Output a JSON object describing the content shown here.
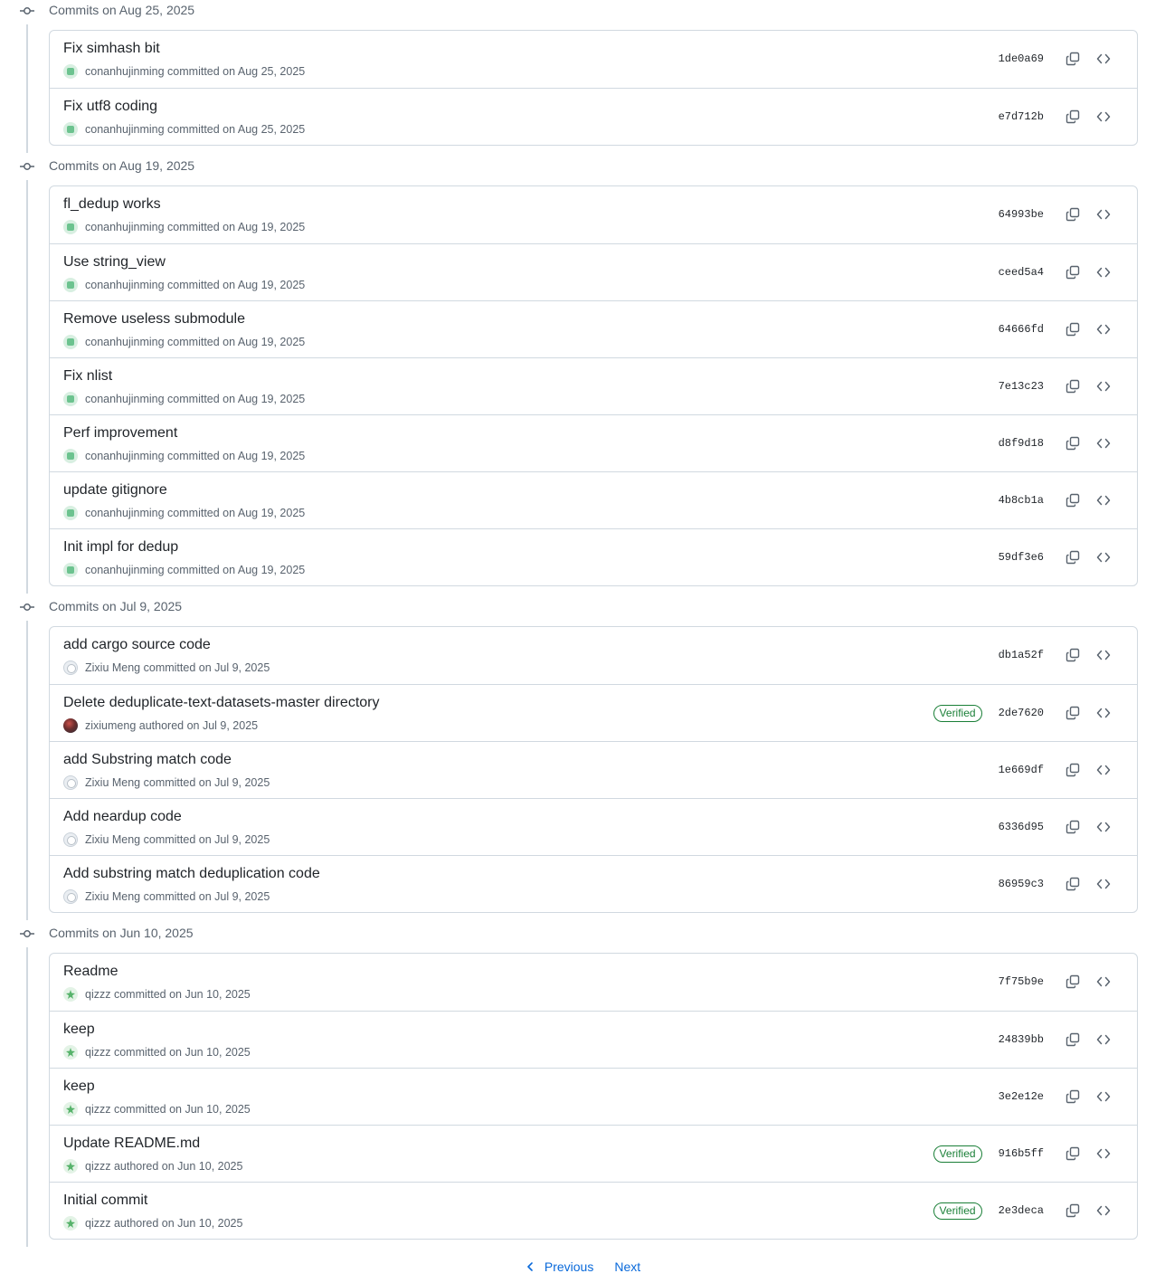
{
  "groups": [
    {
      "title": "Commits on Aug 25, 2025",
      "commits": [
        {
          "message": "Fix simhash bit",
          "author": "conanhujinming",
          "action": "committed on Aug 25, 2025",
          "sha": "1de0a69",
          "verified": false,
          "avatar": "green"
        },
        {
          "message": "Fix utf8 coding",
          "author": "conanhujinming",
          "action": "committed on Aug 25, 2025",
          "sha": "e7d712b",
          "verified": false,
          "avatar": "green"
        }
      ]
    },
    {
      "title": "Commits on Aug 19, 2025",
      "commits": [
        {
          "message": "fl_dedup works",
          "author": "conanhujinming",
          "action": "committed on Aug 19, 2025",
          "sha": "64993be",
          "verified": false,
          "avatar": "green"
        },
        {
          "message": "Use string_view",
          "author": "conanhujinming",
          "action": "committed on Aug 19, 2025",
          "sha": "ceed5a4",
          "verified": false,
          "avatar": "green"
        },
        {
          "message": "Remove useless submodule",
          "author": "conanhujinming",
          "action": "committed on Aug 19, 2025",
          "sha": "64666fd",
          "verified": false,
          "avatar": "green"
        },
        {
          "message": "Fix nlist",
          "author": "conanhujinming",
          "action": "committed on Aug 19, 2025",
          "sha": "7e13c23",
          "verified": false,
          "avatar": "green"
        },
        {
          "message": "Perf improvement",
          "author": "conanhujinming",
          "action": "committed on Aug 19, 2025",
          "sha": "d8f9d18",
          "verified": false,
          "avatar": "green"
        },
        {
          "message": "update gitignore",
          "author": "conanhujinming",
          "action": "committed on Aug 19, 2025",
          "sha": "4b8cb1a",
          "verified": false,
          "avatar": "green"
        },
        {
          "message": "Init impl for dedup",
          "author": "conanhujinming",
          "action": "committed on Aug 19, 2025",
          "sha": "59df3e6",
          "verified": false,
          "avatar": "green"
        }
      ]
    },
    {
      "title": "Commits on Jul 9, 2025",
      "commits": [
        {
          "message": "add cargo source code",
          "author": "Zixiu Meng",
          "action": "committed on Jul 9, 2025",
          "sha": "db1a52f",
          "verified": false,
          "avatar": "gray"
        },
        {
          "message": "Delete deduplicate-text-datasets-master directory",
          "author": "zixiumeng",
          "action": "authored on Jul 9, 2025",
          "sha": "2de7620",
          "verified": true,
          "avatar": "dark"
        },
        {
          "message": "add Substring match code",
          "author": "Zixiu Meng",
          "action": "committed on Jul 9, 2025",
          "sha": "1e669df",
          "verified": false,
          "avatar": "gray"
        },
        {
          "message": "Add neardup code",
          "author": "Zixiu Meng",
          "action": "committed on Jul 9, 2025",
          "sha": "6336d95",
          "verified": false,
          "avatar": "gray"
        },
        {
          "message": "Add substring match deduplication code",
          "author": "Zixiu Meng",
          "action": "committed on Jul 9, 2025",
          "sha": "86959c3",
          "verified": false,
          "avatar": "gray"
        }
      ]
    },
    {
      "title": "Commits on Jun 10, 2025",
      "commits": [
        {
          "message": "Readme",
          "author": "qizzz",
          "action": "committed on Jun 10, 2025",
          "sha": "7f75b9e",
          "verified": false,
          "avatar": "mint"
        },
        {
          "message": "keep",
          "author": "qizzz",
          "action": "committed on Jun 10, 2025",
          "sha": "24839bb",
          "verified": false,
          "avatar": "mint"
        },
        {
          "message": "keep",
          "author": "qizzz",
          "action": "committed on Jun 10, 2025",
          "sha": "3e2e12e",
          "verified": false,
          "avatar": "mint"
        },
        {
          "message": "Update README.md",
          "author": "qizzz",
          "action": "authored on Jun 10, 2025",
          "sha": "916b5ff",
          "verified": true,
          "avatar": "mint"
        },
        {
          "message": "Initial commit",
          "author": "qizzz",
          "action": "authored on Jun 10, 2025",
          "sha": "2e3deca",
          "verified": true,
          "avatar": "mint"
        }
      ]
    }
  ],
  "verified_label": "Verified",
  "icons": {
    "node": "git-commit-icon",
    "copy": "copy-icon",
    "browse": "code-icon",
    "prev": "chevron-left-icon"
  },
  "pagination": {
    "previous_label": "Previous",
    "next_label": "Next"
  },
  "colors": {
    "link": "#0969da",
    "verified": "#1a7f37",
    "border": "#d1d9e0",
    "muted": "#59636e"
  }
}
